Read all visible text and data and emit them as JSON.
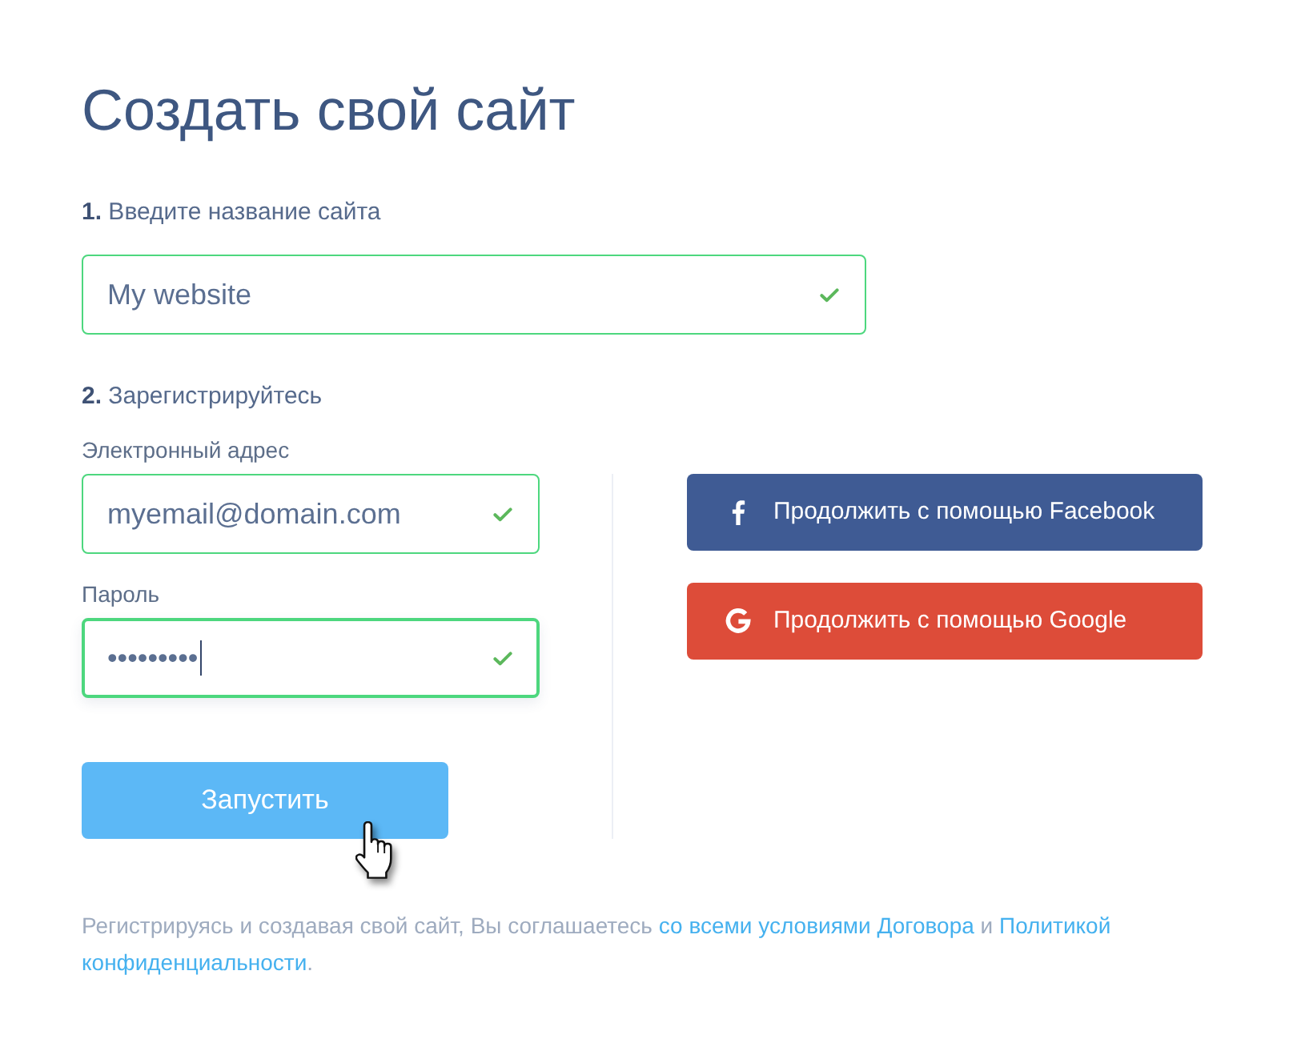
{
  "title": "Создать свой сайт",
  "step_1": {
    "label": "**1.** Введите название сайта",
    "field": {
      "value": "My website",
      "valid": true,
      "focused": false
    }
  },
  "step_2": {
    "label": "**2.** Зарегистрируйтесь",
    "fields": [
      {
        "label": "Электронный адрес",
        "value": "myemail@domain.com",
        "valid": true,
        "focused": false
      },
      {
        "label": "Пароль",
        "value": "•••••••••",
        "valid": true,
        "focused": true
      }
    ],
    "submit_button": "Запустить",
    "social_buttons": [
      {
        "kind": "facebook",
        "label": "Продолжить с помощью Facebook",
        "color": "#3f5b94"
      },
      {
        "kind": "google",
        "label": "Продолжить с помощью Google",
        "color": "#dd4c39"
      }
    ]
  },
  "footer": {
    "segments": [
      {
        "kind": "text",
        "text": "Регистрируясь и создавая свой сайт, Вы соглашаетесь "
      },
      {
        "kind": "link",
        "text": "со всеми условиями Договора"
      },
      {
        "kind": "text",
        "text": " и "
      },
      {
        "kind": "link",
        "text": "Политикой"
      },
      {
        "kind": "link",
        "text": "конфиденциальности"
      },
      {
        "kind": "text",
        "text": "."
      }
    ]
  }
}
